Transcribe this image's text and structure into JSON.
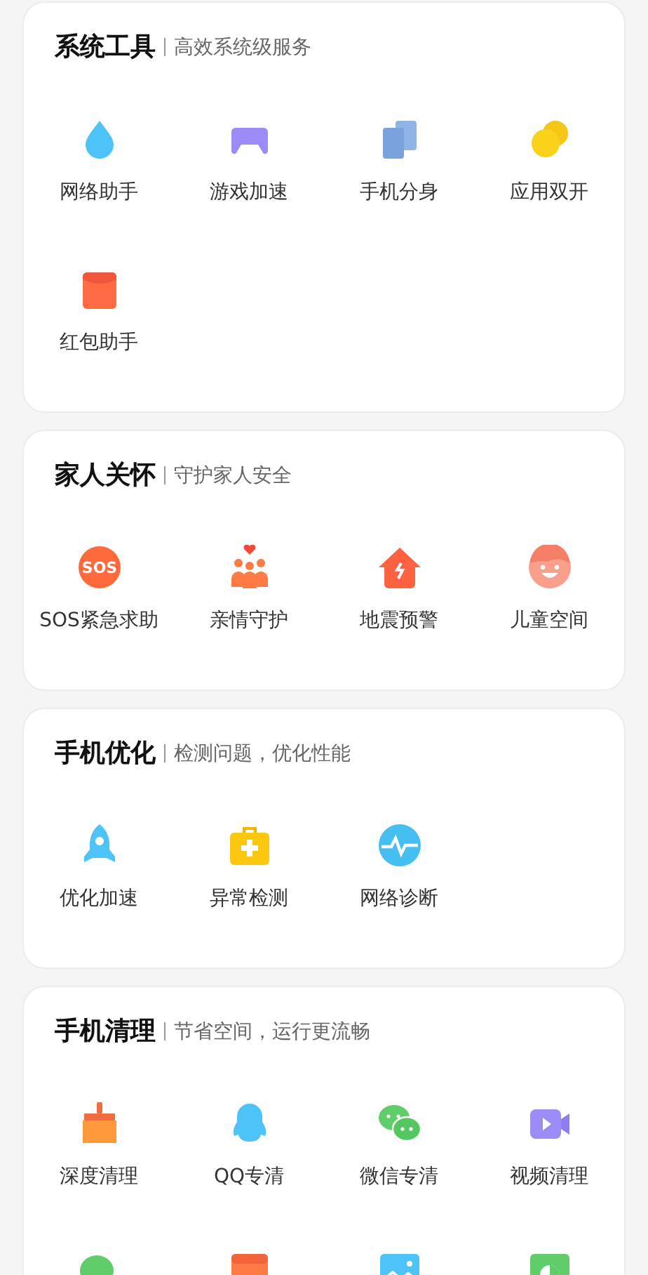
{
  "sections": [
    {
      "title": "系统工具",
      "subtitle": "高效系统级服务",
      "items": [
        {
          "kind": "droplet",
          "label": "网络助手"
        },
        {
          "kind": "gamepad",
          "label": "游戏加速"
        },
        {
          "kind": "copies",
          "label": "手机分身"
        },
        {
          "kind": "coins",
          "label": "应用双开"
        },
        {
          "kind": "packet",
          "label": "红包助手"
        }
      ]
    },
    {
      "title": "家人关怀",
      "subtitle": "守护家人安全",
      "items": [
        {
          "kind": "sos",
          "icon_text": "SOS",
          "label": "SOS紧急求助"
        },
        {
          "kind": "family",
          "label": "亲情守护"
        },
        {
          "kind": "house",
          "label": "地震预警"
        },
        {
          "kind": "kid",
          "label": "儿童空间"
        }
      ]
    },
    {
      "title": "手机优化",
      "subtitle": "检测问题，优化性能",
      "items": [
        {
          "kind": "rocket",
          "label": "优化加速"
        },
        {
          "kind": "medkit",
          "label": "异常检测"
        },
        {
          "kind": "pulse",
          "label": "网络诊断"
        }
      ]
    },
    {
      "title": "手机清理",
      "subtitle": "节省空间，运行更流畅",
      "items": [
        {
          "kind": "broom",
          "label": "深度清理"
        },
        {
          "kind": "penguin",
          "label": "QQ专清"
        },
        {
          "kind": "chat",
          "label": "微信专清"
        },
        {
          "kind": "video",
          "label": "视频清理"
        },
        {
          "kind": "chatbin"
        },
        {
          "kind": "apk"
        },
        {
          "kind": "image"
        },
        {
          "kind": "chart"
        }
      ]
    }
  ]
}
